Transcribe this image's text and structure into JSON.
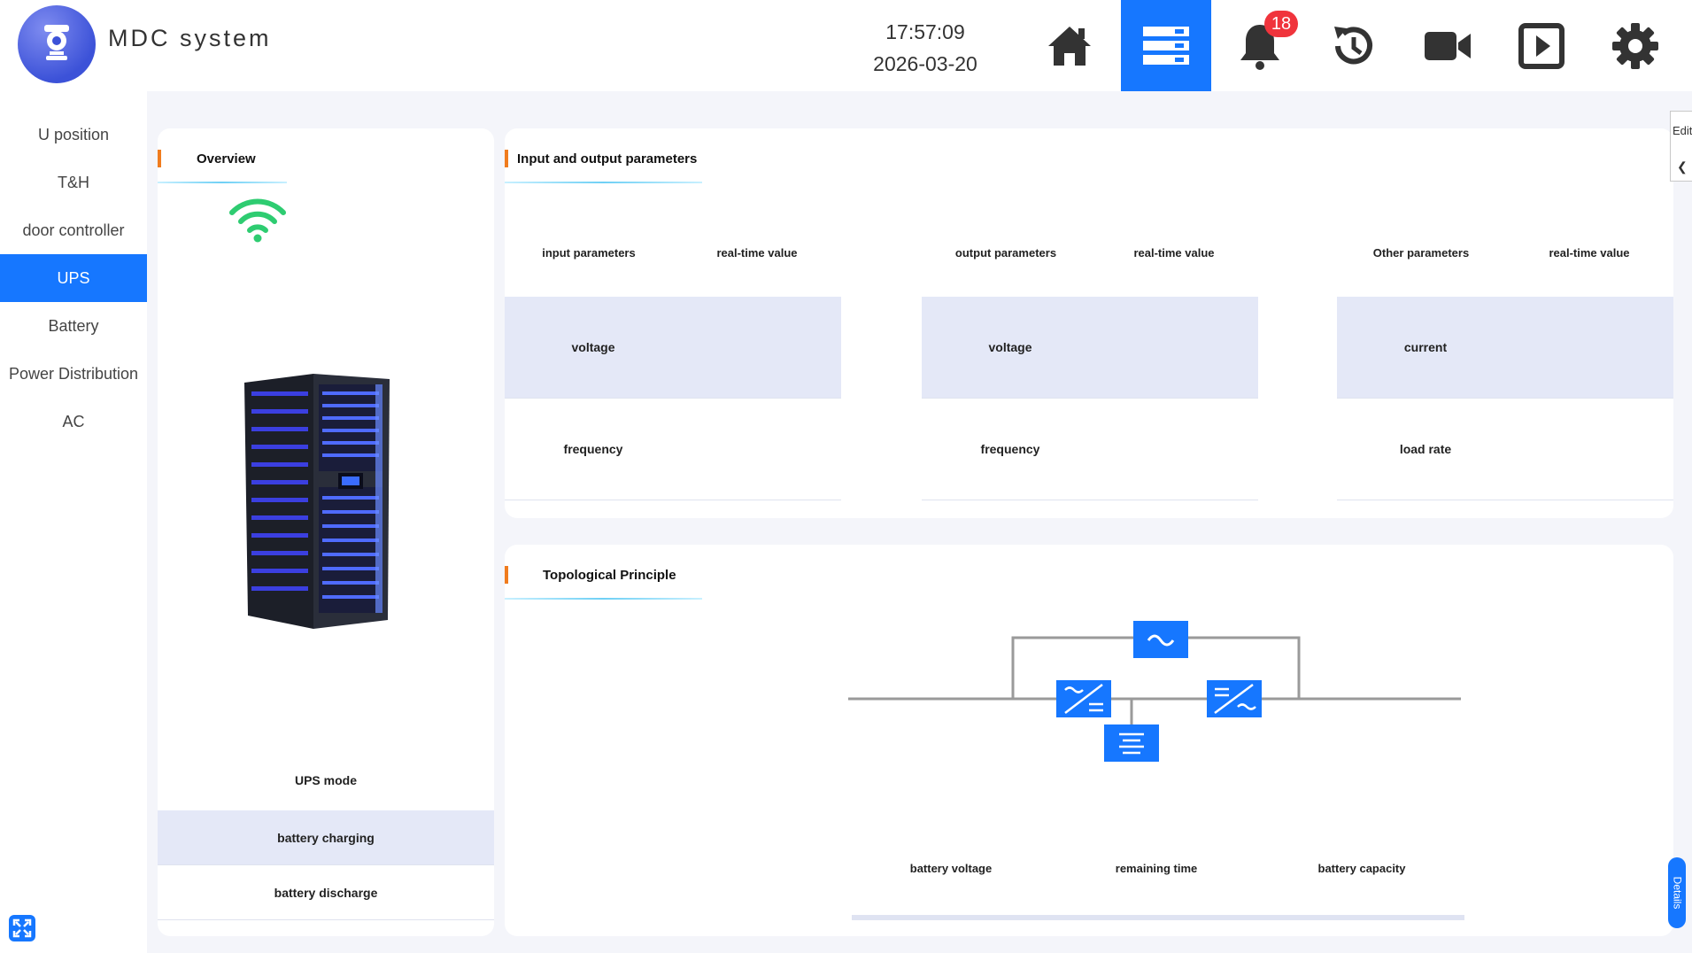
{
  "app": {
    "title": "MDC system"
  },
  "clock": {
    "time": "17:57:09",
    "date": "2026-03-20"
  },
  "nav": [
    {
      "icon": "home-icon"
    },
    {
      "icon": "server-list-icon",
      "active": true
    },
    {
      "icon": "bell-icon",
      "badge": "18"
    },
    {
      "icon": "history-icon"
    },
    {
      "icon": "video-camera-icon"
    },
    {
      "icon": "playback-icon"
    },
    {
      "icon": "gear-icon"
    }
  ],
  "sidebar": {
    "items": [
      {
        "label": "U position"
      },
      {
        "label": "T&H"
      },
      {
        "label": "door controller"
      },
      {
        "label": "UPS",
        "active": true
      },
      {
        "label": "Battery"
      },
      {
        "label": "Power Distribution"
      },
      {
        "label": "AC"
      }
    ]
  },
  "overview": {
    "title": "Overview",
    "ups_mode_label": "UPS mode",
    "rows": [
      "battery charging",
      "battery discharge"
    ]
  },
  "io": {
    "title": "Input and output parameters",
    "tables": [
      {
        "header": "input parameters",
        "value_header": "real-time value",
        "rows": [
          "voltage",
          "frequency"
        ]
      },
      {
        "header": "output parameters",
        "value_header": "real-time value",
        "rows": [
          "voltage",
          "frequency"
        ]
      },
      {
        "header": "Other parameters",
        "value_header": "real-time value",
        "rows": [
          "current",
          "load rate"
        ]
      }
    ]
  },
  "topology": {
    "title": "Topological Principle",
    "labels": [
      "battery voltage",
      "remaining time",
      "battery capacity"
    ]
  },
  "tabs": {
    "edit": "Edit",
    "details": "Details"
  },
  "colors": {
    "accent": "#1677ff",
    "header_bar": "#f07c1e",
    "badge": "#f0343c",
    "wifi": "#2ecc71"
  }
}
